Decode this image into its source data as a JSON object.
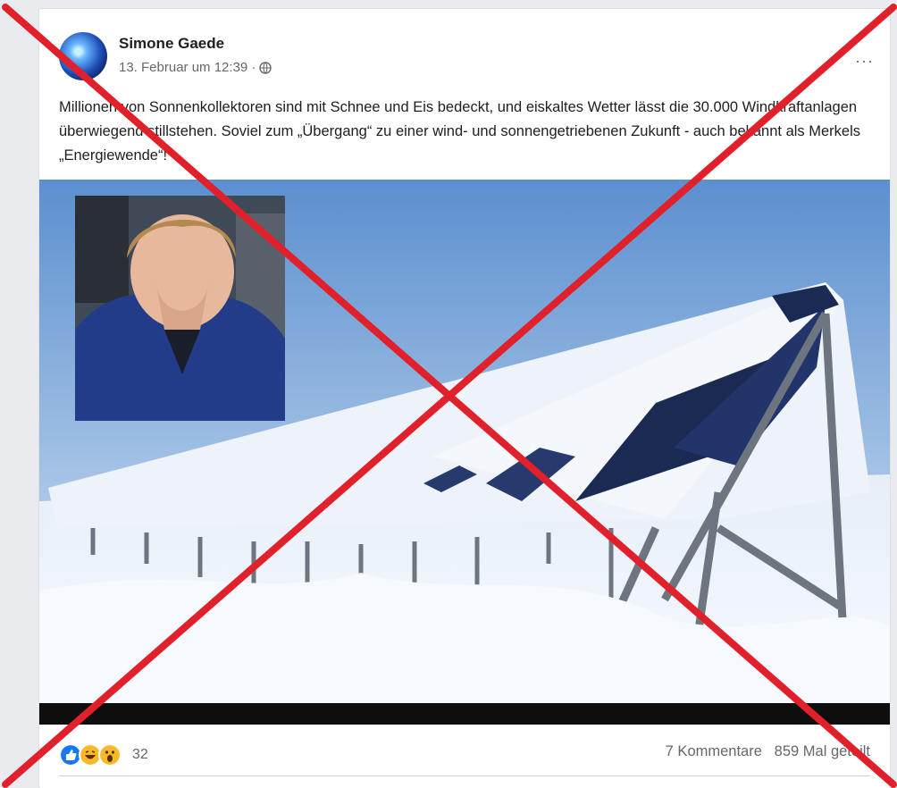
{
  "post": {
    "author": "Simone Gaede",
    "timestamp": "13. Februar um 12:39 ·",
    "privacy_icon": "globe-icon",
    "more_label": "···",
    "text": "Millionen von Sonnenkollektoren sind mit Schnee und Eis bedeckt, und eiskaltes Wetter lässt die 30.000 Windkraftanlagen überwiegend stillstehen. Soviel zum „Übergang“ zu einer wind- und sonnengetriebenen Zukunft - auch bekannt als Merkels „Energiewende“!",
    "image": {
      "inset_subject": "person-covering-mouth-photo",
      "scene": "snow-covered-solar-panels-photo"
    }
  },
  "footer": {
    "reaction_icons": [
      "like-icon",
      "haha-icon",
      "wow-icon"
    ],
    "reaction_count": "32",
    "comments": "7 Kommentare",
    "shares": "859 Mal geteilt"
  },
  "overlay": {
    "cross_icon": "red-x-icon",
    "cross_color": "#e0202a"
  }
}
